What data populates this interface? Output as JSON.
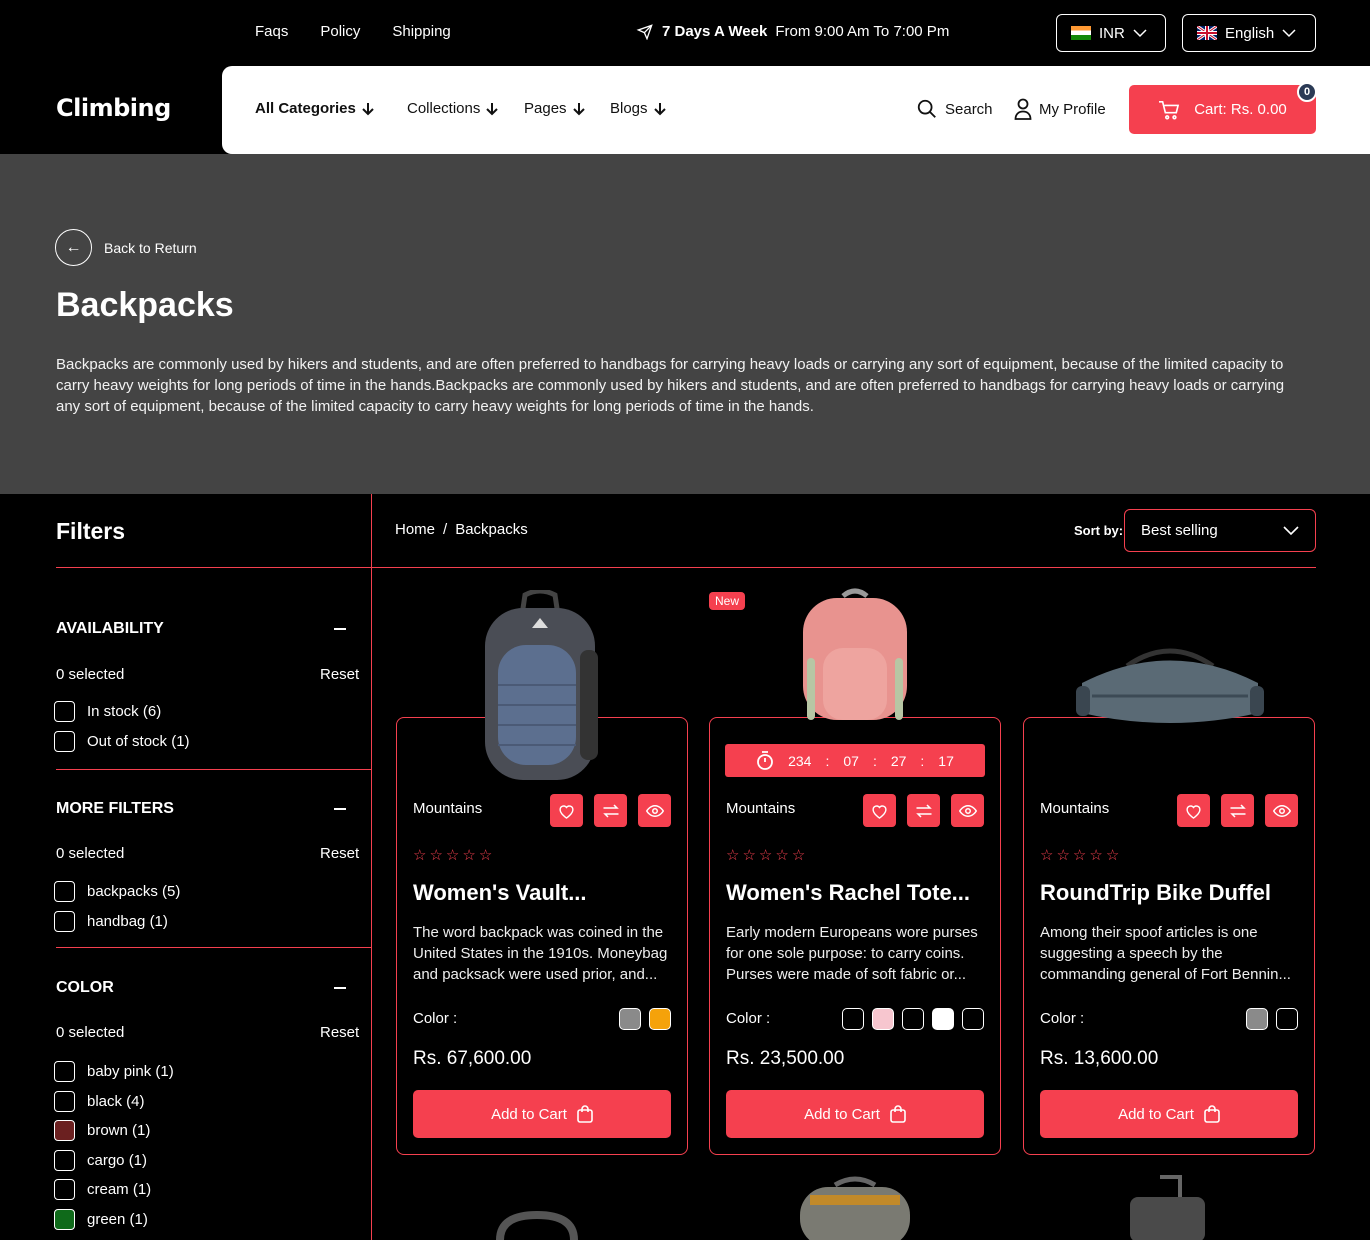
{
  "topbar": {
    "links": [
      "Faqs",
      "Policy",
      "Shipping"
    ],
    "promo_bold": "7 Days A Week",
    "promo_rest": "From 9:00 Am To 7:00 Pm",
    "currency": "INR",
    "language": "English"
  },
  "header": {
    "logo": "Climbing",
    "nav": [
      "All Categories",
      "Collections",
      "Pages",
      "Blogs"
    ],
    "search": "Search",
    "profile": "My Profile",
    "cart": "Cart: Rs. 0.00",
    "cart_count": "0"
  },
  "hero": {
    "back": "Back to Return",
    "title": "Backpacks",
    "description": "Backpacks are commonly used by hikers and students, and are often preferred to handbags for carrying heavy loads or carrying any sort of equipment, because of the limited capacity to carry heavy weights for long periods of time in the hands.Backpacks are commonly used by hikers and students, and are often preferred to handbags for carrying heavy loads or carrying any sort of equipment, because of the limited capacity to carry heavy weights for long periods of time in the hands."
  },
  "filters": {
    "title": "Filters",
    "groups": [
      {
        "title": "AVAILABILITY",
        "selected": "0 selected",
        "reset": "Reset",
        "options": [
          {
            "label": "In stock (6)"
          },
          {
            "label": "Out of stock (1)"
          }
        ]
      },
      {
        "title": "MORE FILTERS",
        "selected": "0 selected",
        "reset": "Reset",
        "options": [
          {
            "label": "backpacks (5)"
          },
          {
            "label": "handbag (1)"
          }
        ]
      },
      {
        "title": "COLOR",
        "selected": "0 selected",
        "reset": "Reset",
        "options": [
          {
            "label": "baby pink (1)",
            "color": ""
          },
          {
            "label": "black (4)",
            "color": ""
          },
          {
            "label": "brown (1)",
            "color": "#6b2020"
          },
          {
            "label": "cargo (1)",
            "color": ""
          },
          {
            "label": "cream (1)",
            "color": ""
          },
          {
            "label": "green (1)",
            "color": "#0f6a1a"
          }
        ]
      }
    ]
  },
  "main": {
    "breadcrumb": [
      "Home",
      "/",
      "Backpacks"
    ],
    "sort_label": "Sort by:",
    "sort_value": "Best selling"
  },
  "products": [
    {
      "brand": "Mountains",
      "title": "Women's Vault...",
      "description": "The word backpack was coined in the United States in the 1910s. Moneybag and packsack were used prior, and...",
      "color_label": "Color :",
      "swatches": [
        "#8a8a8a",
        "#f5a20a"
      ],
      "price": "Rs. 67,600.00",
      "add": "Add to Cart"
    },
    {
      "brand": "Mountains",
      "title": "Women's Rachel Tote...",
      "description": "Early modern Europeans wore purses for one sole purpose: to carry coins. Purses were made of soft fabric or...",
      "color_label": "Color :",
      "swatches": [
        "#000000",
        "#f7c6cf",
        "#000000",
        "#ffffff",
        "#000000"
      ],
      "price": "Rs. 23,500.00",
      "add": "Add to Cart",
      "badge": "New",
      "timer": [
        "234",
        "07",
        "27",
        "17"
      ]
    },
    {
      "brand": "Mountains",
      "title": "RoundTrip Bike Duffel",
      "description": "Among their spoof articles is one suggesting a speech by the commanding general of Fort Bennin...",
      "color_label": "Color :",
      "swatches": [
        "#8a8a8a",
        "#000000"
      ],
      "price": "Rs. 13,600.00",
      "add": "Add to Cart"
    }
  ],
  "colors": {
    "accent": "#f5404f",
    "hero_bg": "#444444",
    "bg": "#000000"
  }
}
